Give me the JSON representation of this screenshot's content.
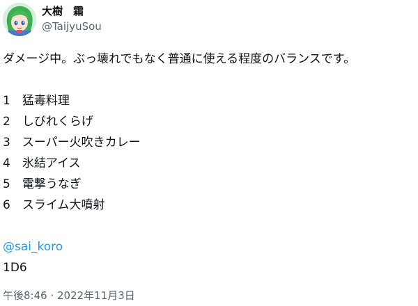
{
  "author": {
    "display_name": "大樹　霜",
    "handle": "@TaijyuSou",
    "avatar": "anime-avatar-green-hair"
  },
  "tweet": {
    "intro": "ダメージ中。ぶっ壊れでもなく普通に使える程度のバランスです。",
    "list": [
      {
        "num": "1",
        "text": "猛毒料理"
      },
      {
        "num": "2",
        "text": "しびれくらげ"
      },
      {
        "num": "3",
        "text": "スーパー火吹きカレー"
      },
      {
        "num": "4",
        "text": "氷結アイス"
      },
      {
        "num": "5",
        "text": "電撃うなぎ"
      },
      {
        "num": "6",
        "text": "スライム大噴射"
      }
    ],
    "mention": "@sai_koro",
    "dice": "1D6",
    "timestamp": "午後8:46 · 2022年11月3日"
  },
  "colors": {
    "text": "#0f1419",
    "secondary": "#536471",
    "link": "#1d9bf0"
  }
}
